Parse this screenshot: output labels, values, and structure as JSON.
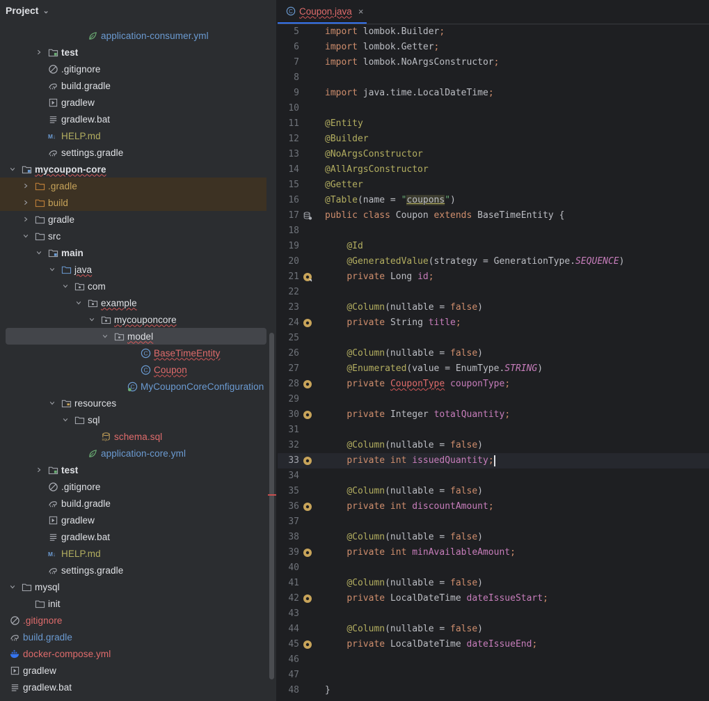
{
  "project": {
    "title": "Project",
    "rows": [
      {
        "label": "application-consumer.yml",
        "depth": 6,
        "arrow": "none",
        "icon": "spring-yaml-icon",
        "color": "#6b9bd2"
      },
      {
        "label": "test",
        "depth": 3,
        "arrow": "right",
        "icon": "test-module-folder-icon",
        "color": "#dfe1e5",
        "bold": true
      },
      {
        "label": ".gitignore",
        "depth": 3,
        "arrow": "none",
        "icon": "gitignore-icon",
        "color": "#dfe1e5"
      },
      {
        "label": "build.gradle",
        "depth": 3,
        "arrow": "none",
        "icon": "gradle-icon",
        "color": "#dfe1e5"
      },
      {
        "label": "gradlew",
        "depth": 3,
        "arrow": "none",
        "icon": "executable-icon",
        "color": "#dfe1e5"
      },
      {
        "label": "gradlew.bat",
        "depth": 3,
        "arrow": "none",
        "icon": "text-file-icon",
        "color": "#dfe1e5"
      },
      {
        "label": "HELP.md",
        "depth": 3,
        "arrow": "none",
        "icon": "markdown-icon",
        "color": "#b3ae60"
      },
      {
        "label": "settings.gradle",
        "depth": 3,
        "arrow": "none",
        "icon": "gradle-icon",
        "color": "#dfe1e5"
      },
      {
        "label": "mycoupon-core",
        "depth": 1,
        "arrow": "down",
        "icon": "module-folder-icon",
        "color": "#dfe1e5",
        "bold": true,
        "err": true
      },
      {
        "label": ".gradle",
        "depth": 2,
        "arrow": "right",
        "icon": "excluded-folder-icon",
        "color": "#c8a45a",
        "hl": true
      },
      {
        "label": "build",
        "depth": 2,
        "arrow": "right",
        "icon": "excluded-folder-icon",
        "color": "#c8a45a",
        "hl": true
      },
      {
        "label": "gradle",
        "depth": 2,
        "arrow": "right",
        "icon": "folder-icon",
        "color": "#dfe1e5"
      },
      {
        "label": "src",
        "depth": 2,
        "arrow": "down",
        "icon": "folder-icon",
        "color": "#dfe1e5"
      },
      {
        "label": "main",
        "depth": 3,
        "arrow": "down",
        "icon": "module-folder-icon",
        "color": "#dfe1e5",
        "bold": true
      },
      {
        "label": "java",
        "depth": 4,
        "arrow": "down",
        "icon": "source-folder-icon",
        "color": "#dfe1e5",
        "err": true
      },
      {
        "label": "com",
        "depth": 5,
        "arrow": "down",
        "icon": "package-icon",
        "color": "#dfe1e5"
      },
      {
        "label": "example",
        "depth": 6,
        "arrow": "down",
        "icon": "package-icon",
        "color": "#dfe1e5",
        "err": true
      },
      {
        "label": "mycouponcore",
        "depth": 7,
        "arrow": "down",
        "icon": "package-icon",
        "color": "#dfe1e5",
        "err": true
      },
      {
        "label": "model",
        "depth": 8,
        "arrow": "down",
        "icon": "package-icon",
        "color": "#dfe1e5",
        "err": true,
        "sel": true
      },
      {
        "label": "BaseTimeEntity",
        "depth": 10,
        "arrow": "none",
        "icon": "class-icon",
        "color": "#e06c6c",
        "err": true
      },
      {
        "label": "Coupon",
        "depth": 10,
        "arrow": "none",
        "icon": "class-icon",
        "color": "#e06c6c",
        "err": true
      },
      {
        "label": "MyCouponCoreConfiguration",
        "depth": 9,
        "arrow": "none",
        "icon": "config-class-icon",
        "color": "#6b9bd2"
      },
      {
        "label": "resources",
        "depth": 4,
        "arrow": "down",
        "icon": "resources-folder-icon",
        "color": "#dfe1e5"
      },
      {
        "label": "sql",
        "depth": 5,
        "arrow": "down",
        "icon": "folder-icon",
        "color": "#dfe1e5"
      },
      {
        "label": "schema.sql",
        "depth": 7,
        "arrow": "none",
        "icon": "sql-file-icon",
        "color": "#e06c6c"
      },
      {
        "label": "application-core.yml",
        "depth": 6,
        "arrow": "none",
        "icon": "spring-yaml-icon",
        "color": "#6b9bd2"
      },
      {
        "label": "test",
        "depth": 3,
        "arrow": "right",
        "icon": "test-module-folder-icon",
        "color": "#dfe1e5",
        "bold": true
      },
      {
        "label": ".gitignore",
        "depth": 3,
        "arrow": "none",
        "icon": "gitignore-icon",
        "color": "#dfe1e5"
      },
      {
        "label": "build.gradle",
        "depth": 3,
        "arrow": "none",
        "icon": "gradle-icon",
        "color": "#dfe1e5"
      },
      {
        "label": "gradlew",
        "depth": 3,
        "arrow": "none",
        "icon": "executable-icon",
        "color": "#dfe1e5"
      },
      {
        "label": "gradlew.bat",
        "depth": 3,
        "arrow": "none",
        "icon": "text-file-icon",
        "color": "#dfe1e5"
      },
      {
        "label": "HELP.md",
        "depth": 3,
        "arrow": "none",
        "icon": "markdown-icon",
        "color": "#b3ae60"
      },
      {
        "label": "settings.gradle",
        "depth": 3,
        "arrow": "none",
        "icon": "gradle-icon",
        "color": "#dfe1e5"
      },
      {
        "label": "mysql",
        "depth": 1,
        "arrow": "down",
        "icon": "folder-icon",
        "color": "#dfe1e5"
      },
      {
        "label": "init",
        "depth": 2,
        "arrow": "none",
        "icon": "folder-icon",
        "color": "#dfe1e5"
      },
      {
        "label": ".gitignore",
        "depth": 2,
        "arrow": "none",
        "icon": "gitignore-icon",
        "color": "#e06c6c",
        "noarrowspace": true
      },
      {
        "label": "build.gradle",
        "depth": 2,
        "arrow": "none",
        "icon": "gradle-icon",
        "color": "#6b9bd2",
        "noarrowspace": true
      },
      {
        "label": "docker-compose.yml",
        "depth": 2,
        "arrow": "none",
        "icon": "docker-icon",
        "color": "#e06c6c",
        "noarrowspace": true
      },
      {
        "label": "gradlew",
        "depth": 2,
        "arrow": "none",
        "icon": "executable-icon",
        "color": "#dfe1e5",
        "noarrowspace": true
      },
      {
        "label": "gradlew.bat",
        "depth": 2,
        "arrow": "none",
        "icon": "text-file-icon",
        "color": "#dfe1e5",
        "noarrowspace": true
      }
    ]
  },
  "editor": {
    "tab": {
      "label": "Coupon.java",
      "close": "×",
      "icon": "class-icon"
    },
    "lines": [
      {
        "n": "5",
        "segs": [
          [
            "kw",
            "import "
          ],
          [
            "",
            "lombok.Builder"
          ],
          [
            "kw",
            ";"
          ]
        ]
      },
      {
        "n": "6",
        "segs": [
          [
            "kw",
            "import "
          ],
          [
            "",
            "lombok.Getter"
          ],
          [
            "kw",
            ";"
          ]
        ]
      },
      {
        "n": "7",
        "segs": [
          [
            "kw",
            "import "
          ],
          [
            "",
            "lombok.NoArgsConstructor"
          ],
          [
            "kw",
            ";"
          ]
        ]
      },
      {
        "n": "8",
        "segs": []
      },
      {
        "n": "9",
        "segs": [
          [
            "kw",
            "import "
          ],
          [
            "",
            "java.time.LocalDateTime"
          ],
          [
            "kw",
            ";"
          ]
        ]
      },
      {
        "n": "10",
        "segs": []
      },
      {
        "n": "11",
        "segs": [
          [
            "an",
            "@Entity"
          ]
        ]
      },
      {
        "n": "12",
        "segs": [
          [
            "an",
            "@Builder"
          ]
        ]
      },
      {
        "n": "13",
        "segs": [
          [
            "an",
            "@NoArgsConstructor"
          ]
        ]
      },
      {
        "n": "14",
        "segs": [
          [
            "an",
            "@AllArgsConstructor"
          ]
        ]
      },
      {
        "n": "15",
        "segs": [
          [
            "an",
            "@Getter"
          ]
        ]
      },
      {
        "n": "16",
        "segs": [
          [
            "an",
            "@Table"
          ],
          [
            "",
            "(name = "
          ],
          [
            "str",
            "\""
          ],
          [
            "coupons",
            "coupons"
          ],
          [
            "str",
            "\""
          ],
          [
            "",
            ")"
          ]
        ]
      },
      {
        "n": "17",
        "gutter": "db-icon",
        "segs": [
          [
            "kw",
            "public class "
          ],
          [
            "",
            "Coupon "
          ],
          [
            "kw",
            "extends "
          ],
          [
            "",
            "BaseTimeEntity {"
          ]
        ]
      },
      {
        "n": "18",
        "segs": []
      },
      {
        "n": "19",
        "segs": [
          [
            "",
            "    "
          ],
          [
            "an",
            "@Id"
          ]
        ]
      },
      {
        "n": "20",
        "segs": [
          [
            "",
            "    "
          ],
          [
            "an",
            "@GeneratedValue"
          ],
          [
            "",
            "(strategy = GenerationType."
          ],
          [
            "ital",
            "SEQUENCE"
          ],
          [
            "",
            ")"
          ]
        ]
      },
      {
        "n": "21",
        "gutter": "column-key-icon",
        "segs": [
          [
            "",
            "    "
          ],
          [
            "kw",
            "private "
          ],
          [
            "",
            "Long "
          ],
          [
            "fld",
            "id"
          ],
          [
            "kw",
            ";"
          ]
        ]
      },
      {
        "n": "22",
        "segs": []
      },
      {
        "n": "23",
        "segs": [
          [
            "",
            "    "
          ],
          [
            "an",
            "@Column"
          ],
          [
            "",
            "(nullable = "
          ],
          [
            "kw",
            "false"
          ],
          [
            "",
            ")"
          ]
        ]
      },
      {
        "n": "24",
        "gutter": "column-icon",
        "segs": [
          [
            "",
            "    "
          ],
          [
            "kw",
            "private "
          ],
          [
            "",
            "String "
          ],
          [
            "fld",
            "title"
          ],
          [
            "kw",
            ";"
          ]
        ]
      },
      {
        "n": "25",
        "segs": []
      },
      {
        "n": "26",
        "segs": [
          [
            "",
            "    "
          ],
          [
            "an",
            "@Column"
          ],
          [
            "",
            "(nullable = "
          ],
          [
            "kw",
            "false"
          ],
          [
            "",
            ")"
          ]
        ]
      },
      {
        "n": "27",
        "segs": [
          [
            "",
            "    "
          ],
          [
            "an",
            "@Enumerated"
          ],
          [
            "",
            "(value = EnumType."
          ],
          [
            "ital",
            "STRING"
          ],
          [
            "",
            ")"
          ]
        ]
      },
      {
        "n": "28",
        "gutter": "column-icon",
        "segs": [
          [
            "",
            "    "
          ],
          [
            "kw",
            "private "
          ],
          [
            "errtype",
            "CouponType"
          ],
          [
            "",
            " "
          ],
          [
            "fld",
            "couponType"
          ],
          [
            "kw",
            ";"
          ]
        ]
      },
      {
        "n": "29",
        "segs": []
      },
      {
        "n": "30",
        "gutter": "column-icon",
        "segs": [
          [
            "",
            "    "
          ],
          [
            "kw",
            "private "
          ],
          [
            "",
            "Integer "
          ],
          [
            "fld",
            "totalQuantity"
          ],
          [
            "kw",
            ";"
          ]
        ]
      },
      {
        "n": "31",
        "segs": []
      },
      {
        "n": "32",
        "segs": [
          [
            "",
            "    "
          ],
          [
            "an",
            "@Column"
          ],
          [
            "",
            "(nullable = "
          ],
          [
            "kw",
            "false"
          ],
          [
            "",
            ")"
          ]
        ]
      },
      {
        "n": "33",
        "gutter": "column-icon",
        "cur": true,
        "segs": [
          [
            "",
            "    "
          ],
          [
            "kw",
            "private int "
          ],
          [
            "fld",
            "issuedQuantity"
          ],
          [
            "kw",
            ";"
          ],
          [
            "caret",
            ""
          ]
        ]
      },
      {
        "n": "34",
        "segs": []
      },
      {
        "n": "35",
        "segs": [
          [
            "",
            "    "
          ],
          [
            "an",
            "@Column"
          ],
          [
            "",
            "(nullable = "
          ],
          [
            "kw",
            "false"
          ],
          [
            "",
            ")"
          ]
        ]
      },
      {
        "n": "36",
        "gutter": "column-icon",
        "segs": [
          [
            "",
            "    "
          ],
          [
            "kw",
            "private int "
          ],
          [
            "fld",
            "discountAmount"
          ],
          [
            "kw",
            ";"
          ]
        ]
      },
      {
        "n": "37",
        "segs": []
      },
      {
        "n": "38",
        "segs": [
          [
            "",
            "    "
          ],
          [
            "an",
            "@Column"
          ],
          [
            "",
            "(nullable = "
          ],
          [
            "kw",
            "false"
          ],
          [
            "",
            ")"
          ]
        ]
      },
      {
        "n": "39",
        "gutter": "column-icon",
        "segs": [
          [
            "",
            "    "
          ],
          [
            "kw",
            "private int "
          ],
          [
            "fld",
            "minAvailableAmount"
          ],
          [
            "kw",
            ";"
          ]
        ]
      },
      {
        "n": "40",
        "segs": []
      },
      {
        "n": "41",
        "segs": [
          [
            "",
            "    "
          ],
          [
            "an",
            "@Column"
          ],
          [
            "",
            "(nullable = "
          ],
          [
            "kw",
            "false"
          ],
          [
            "",
            ")"
          ]
        ]
      },
      {
        "n": "42",
        "gutter": "column-icon",
        "segs": [
          [
            "",
            "    "
          ],
          [
            "kw",
            "private "
          ],
          [
            "",
            "LocalDateTime "
          ],
          [
            "fld",
            "dateIssueStart"
          ],
          [
            "kw",
            ";"
          ]
        ]
      },
      {
        "n": "43",
        "segs": []
      },
      {
        "n": "44",
        "segs": [
          [
            "",
            "    "
          ],
          [
            "an",
            "@Column"
          ],
          [
            "",
            "(nullable = "
          ],
          [
            "kw",
            "false"
          ],
          [
            "",
            ")"
          ]
        ]
      },
      {
        "n": "45",
        "gutter": "column-icon",
        "segs": [
          [
            "",
            "    "
          ],
          [
            "kw",
            "private "
          ],
          [
            "",
            "LocalDateTime "
          ],
          [
            "fld",
            "dateIssueEnd"
          ],
          [
            "kw",
            ";"
          ]
        ]
      },
      {
        "n": "46",
        "segs": []
      },
      {
        "n": "47",
        "segs": []
      },
      {
        "n": "48",
        "segs": [
          [
            "",
            "}"
          ]
        ]
      }
    ]
  },
  "colors": {
    "background": "#1e1f22",
    "panel": "#2b2d30",
    "accent": "#3574f0",
    "keyword": "#cf8e6d",
    "annotation": "#b3ae60",
    "field": "#c77dbb",
    "string": "#6aab73",
    "error": "#e06c6c"
  }
}
